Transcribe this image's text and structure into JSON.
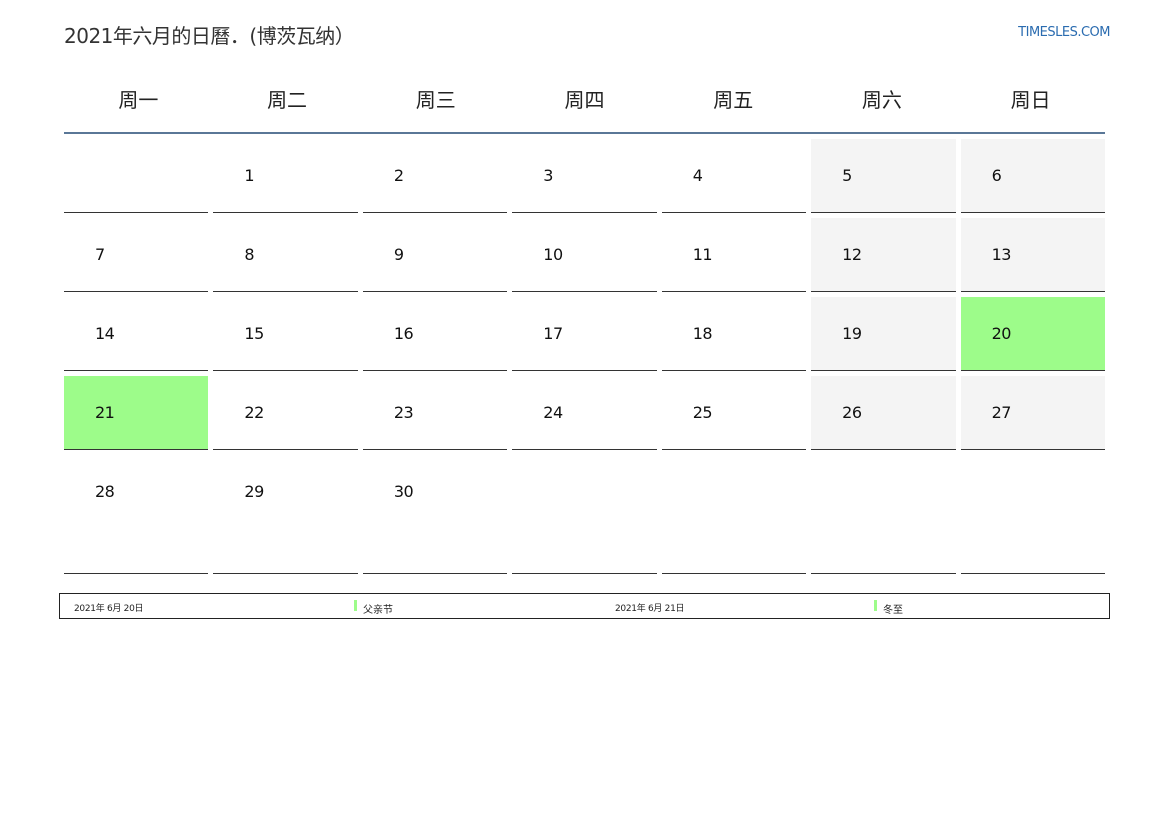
{
  "header": {
    "title": "2021年六月的日曆．(博茨瓦纳）",
    "site": "TIMESLES.COM"
  },
  "weekdays": [
    "周一",
    "周二",
    "周三",
    "周四",
    "周五",
    "周六",
    "周日"
  ],
  "weeks": [
    [
      "",
      "1",
      "2",
      "3",
      "4",
      "5",
      "6"
    ],
    [
      "7",
      "8",
      "9",
      "10",
      "11",
      "12",
      "13"
    ],
    [
      "14",
      "15",
      "16",
      "17",
      "18",
      "19",
      "20"
    ],
    [
      "21",
      "22",
      "23",
      "24",
      "25",
      "26",
      "27"
    ],
    [
      "28",
      "29",
      "30",
      "",
      "",
      "",
      ""
    ]
  ],
  "holidays": [
    "20",
    "21"
  ],
  "legend": [
    {
      "date": "2021年 6月 20日",
      "name": "父亲节"
    },
    {
      "date": "2021年 6月 21日",
      "name": "冬至"
    }
  ],
  "colors": {
    "holiday": "#9dfc8a",
    "weekend": "#f4f4f4",
    "header_rule": "#5a7797",
    "site_link": "#2b6cb0"
  }
}
